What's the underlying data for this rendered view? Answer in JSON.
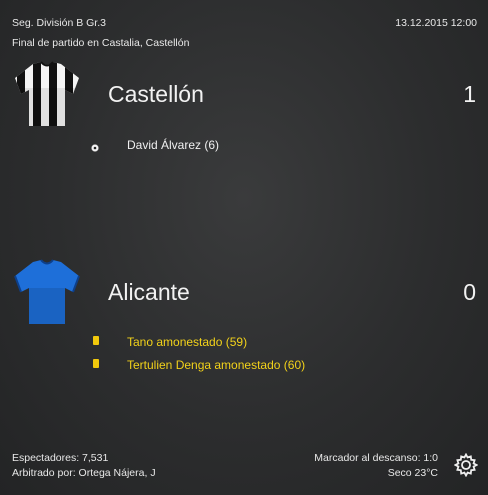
{
  "header": {
    "competition": "Seg. División B Gr.3",
    "datetime": "13.12.2015 12:00",
    "status": "Final de partido en Castalia, Castellón"
  },
  "home": {
    "name": "Castellón",
    "score": "1",
    "kit": "black-white-striped-shirt-icon",
    "events": [
      {
        "type": "goal",
        "icon": "football-icon",
        "text": "David Álvarez (6)"
      }
    ]
  },
  "away": {
    "name": "Alicante",
    "score": "0",
    "kit": "blue-shirt-icon",
    "events": [
      {
        "type": "yellow-card",
        "icon": "yellow-card-icon",
        "text": "Tano amonestado (59)"
      },
      {
        "type": "yellow-card",
        "icon": "yellow-card-icon",
        "text": "Tertulien Denga amonestado (60)"
      }
    ]
  },
  "footer": {
    "attendance": "Espectadores: 7,531",
    "referee": "Arbitrado por: Ortega Nájera, J",
    "halftime": "Marcador al descanso: 1:0",
    "weather": "Seco 23°C",
    "settings_icon": "gear-icon"
  },
  "colors": {
    "card_text": "#f2d21a",
    "yellow_card": "#f2c90c",
    "away_kit": "#1e6fd9"
  }
}
